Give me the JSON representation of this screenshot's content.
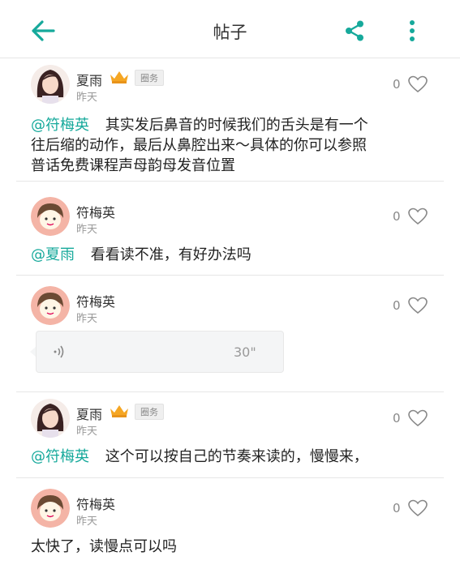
{
  "header": {
    "title": "帖子",
    "back_icon": "back-arrow-icon",
    "share_icon": "share-icon",
    "more_icon": "more-vertical-icon",
    "accent": "#16a99b"
  },
  "posts": [
    {
      "user": "夏雨",
      "badge": "圈务",
      "time": "昨天",
      "likes": "0",
      "mention": "@符梅英",
      "line1": "其实发后鼻音的时候我们的舌头是有一个",
      "line2": "往后缩的动作，最后从鼻腔出来～具体的你可以参照",
      "line3": "普话免费课程声母韵母发音位置"
    },
    {
      "user": "符梅英",
      "time": "昨天",
      "likes": "0",
      "mention": "@夏雨",
      "content": "看看读不准，有好办法吗"
    },
    {
      "user": "符梅英",
      "time": "昨天",
      "likes": "0",
      "voice_duration": "30\""
    },
    {
      "user": "夏雨",
      "badge": "圈务",
      "time": "昨天",
      "likes": "0",
      "mention": "@符梅英",
      "content": "这个可以按自己的节奏来读的，慢慢来，"
    },
    {
      "user": "符梅英",
      "time": "昨天",
      "likes": "0",
      "content": "太快了，读慢点可以吗"
    }
  ]
}
